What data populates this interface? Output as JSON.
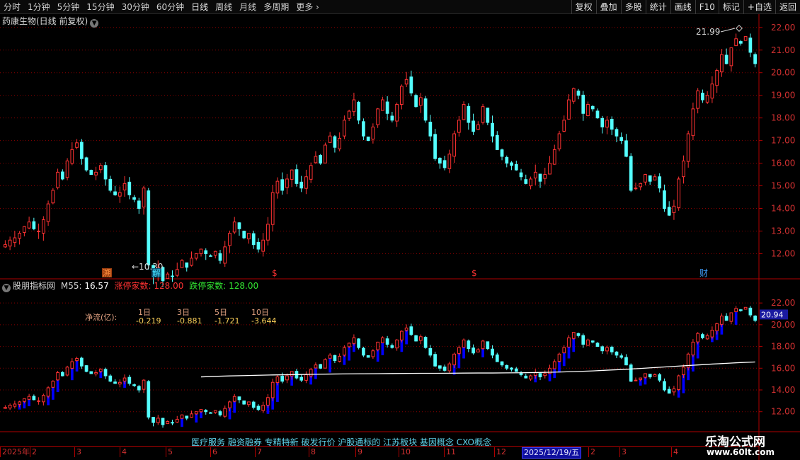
{
  "toolbar": {
    "timeframes": [
      "分时",
      "1分钟",
      "5分钟",
      "15分钟",
      "30分钟",
      "60分钟",
      "日线",
      "周线",
      "月线",
      "多周期",
      "更多"
    ],
    "buttons": [
      "复权",
      "叠加",
      "多股",
      "统计",
      "画线",
      "F10",
      "标记",
      "+自选",
      "返回"
    ]
  },
  "main_title": "药康生物(日线 前复权)",
  "indicator": {
    "name": "股朋指标网",
    "ma_label": "M55:",
    "ma_value": "16.57",
    "limit_up_label": "涨停家数:",
    "limit_up_value": "128.00",
    "limit_down_label": "跌停家数:",
    "limit_down_value": "128.00"
  },
  "net_flow": {
    "label": "净流(亿):",
    "periods": [
      "1日",
      "3日",
      "5日",
      "10日"
    ],
    "values": [
      "-0.219",
      "-0.881",
      "-1.721",
      "-3.644"
    ]
  },
  "price_axis": {
    "labels": [
      "22.00",
      "21.00",
      "20.00",
      "19.00",
      "18.00",
      "17.00",
      "16.00",
      "15.00",
      "14.00",
      "13.00",
      "12.00"
    ]
  },
  "indicator_axis": {
    "labels": [
      "22.00",
      "20.00",
      "18.00",
      "16.00",
      "14.00",
      "12.00"
    ],
    "current_value": "20.94"
  },
  "annotations": {
    "high": "21.99",
    "low": "10.30",
    "markers": [
      "溯",
      "解",
      "$",
      "$",
      "财"
    ]
  },
  "concepts": "医疗服务 融资融券 专精特新 破发行价 沪股通标的 江苏板块 基因概念 CXO概念",
  "dates": [
    "2025年",
    "2",
    "3",
    "4",
    "5",
    "6",
    "7",
    "8",
    "9",
    "10",
    "11",
    "12",
    "2025/12/19/五",
    "2",
    "3",
    "4"
  ],
  "watermark": {
    "name": "乐淘公式网",
    "url": "www.60lt.com"
  },
  "colors": {
    "up": "#ff3232",
    "down": "#54ffff",
    "ma": "#ffffff",
    "arrow": "#1a2aff",
    "grid": "#8a0000",
    "volume_bar": "#0000ff"
  },
  "chart_data": {
    "type": "candlestick",
    "y_range": [
      11.2,
      22.4
    ],
    "indicator_y_range": [
      11.2,
      22.4
    ],
    "closes": [
      12.4,
      12.6,
      12.7,
      12.9,
      13.2,
      13.4,
      13.1,
      13.0,
      13.5,
      14.2,
      14.8,
      15.6,
      15.3,
      16.1,
      16.6,
      16.9,
      16.2,
      15.7,
      15.5,
      15.6,
      15.9,
      15.3,
      14.8,
      14.6,
      14.7,
      15.1,
      14.6,
      14.4,
      14.0,
      14.9,
      11.5,
      11.0,
      11.4,
      10.8,
      11.1,
      11.0,
      11.3,
      11.7,
      11.4,
      11.8,
      12.0,
      12.2,
      12.0,
      11.9,
      12.1,
      11.7,
      12.3,
      12.9,
      13.4,
      13.1,
      12.7,
      12.9,
      12.4,
      12.2,
      12.6,
      13.3,
      14.7,
      15.2,
      14.8,
      15.3,
      15.7,
      15.1,
      14.9,
      15.4,
      15.9,
      16.3,
      16.0,
      16.8,
      17.2,
      16.7,
      17.1,
      17.9,
      18.3,
      18.8,
      17.9,
      17.2,
      17.0,
      17.6,
      18.4,
      18.8,
      18.2,
      17.9,
      18.6,
      19.4,
      19.7,
      19.1,
      18.5,
      18.9,
      17.9,
      17.2,
      16.2,
      16.0,
      15.8,
      16.4,
      17.3,
      17.9,
      18.6,
      17.8,
      17.4,
      17.7,
      18.5,
      17.8,
      17.2,
      16.6,
      16.3,
      16.0,
      15.9,
      15.7,
      15.4,
      15.1,
      15.3,
      15.6,
      15.2,
      15.5,
      16.0,
      16.6,
      17.3,
      17.9,
      18.8,
      19.3,
      19.0,
      18.2,
      18.6,
      18.4,
      18.0,
      17.6,
      17.9,
      17.5,
      17.2,
      17.0,
      16.3,
      14.8,
      14.9,
      15.1,
      15.5,
      15.2,
      15.4,
      14.9,
      14.0,
      13.7,
      14.1,
      15.3,
      16.1,
      17.3,
      18.4,
      19.2,
      18.8,
      19.0,
      19.5,
      20.1,
      20.8,
      20.4,
      21.1,
      21.5,
      21.3,
      21.6,
      20.9,
      20.4
    ],
    "ma55": [
      15.2,
      15.25,
      15.29,
      15.32,
      15.35,
      15.38,
      15.4,
      15.42,
      15.44,
      15.46,
      15.48,
      15.49,
      15.5,
      15.51,
      15.52,
      15.53,
      15.53,
      15.54,
      15.55,
      15.56,
      15.56,
      15.57,
      15.58,
      15.6,
      15.63,
      15.66,
      15.7,
      15.75,
      15.82,
      15.9,
      15.98,
      16.06,
      16.14,
      16.22,
      16.3,
      16.38,
      16.45,
      16.52,
      16.57
    ]
  }
}
